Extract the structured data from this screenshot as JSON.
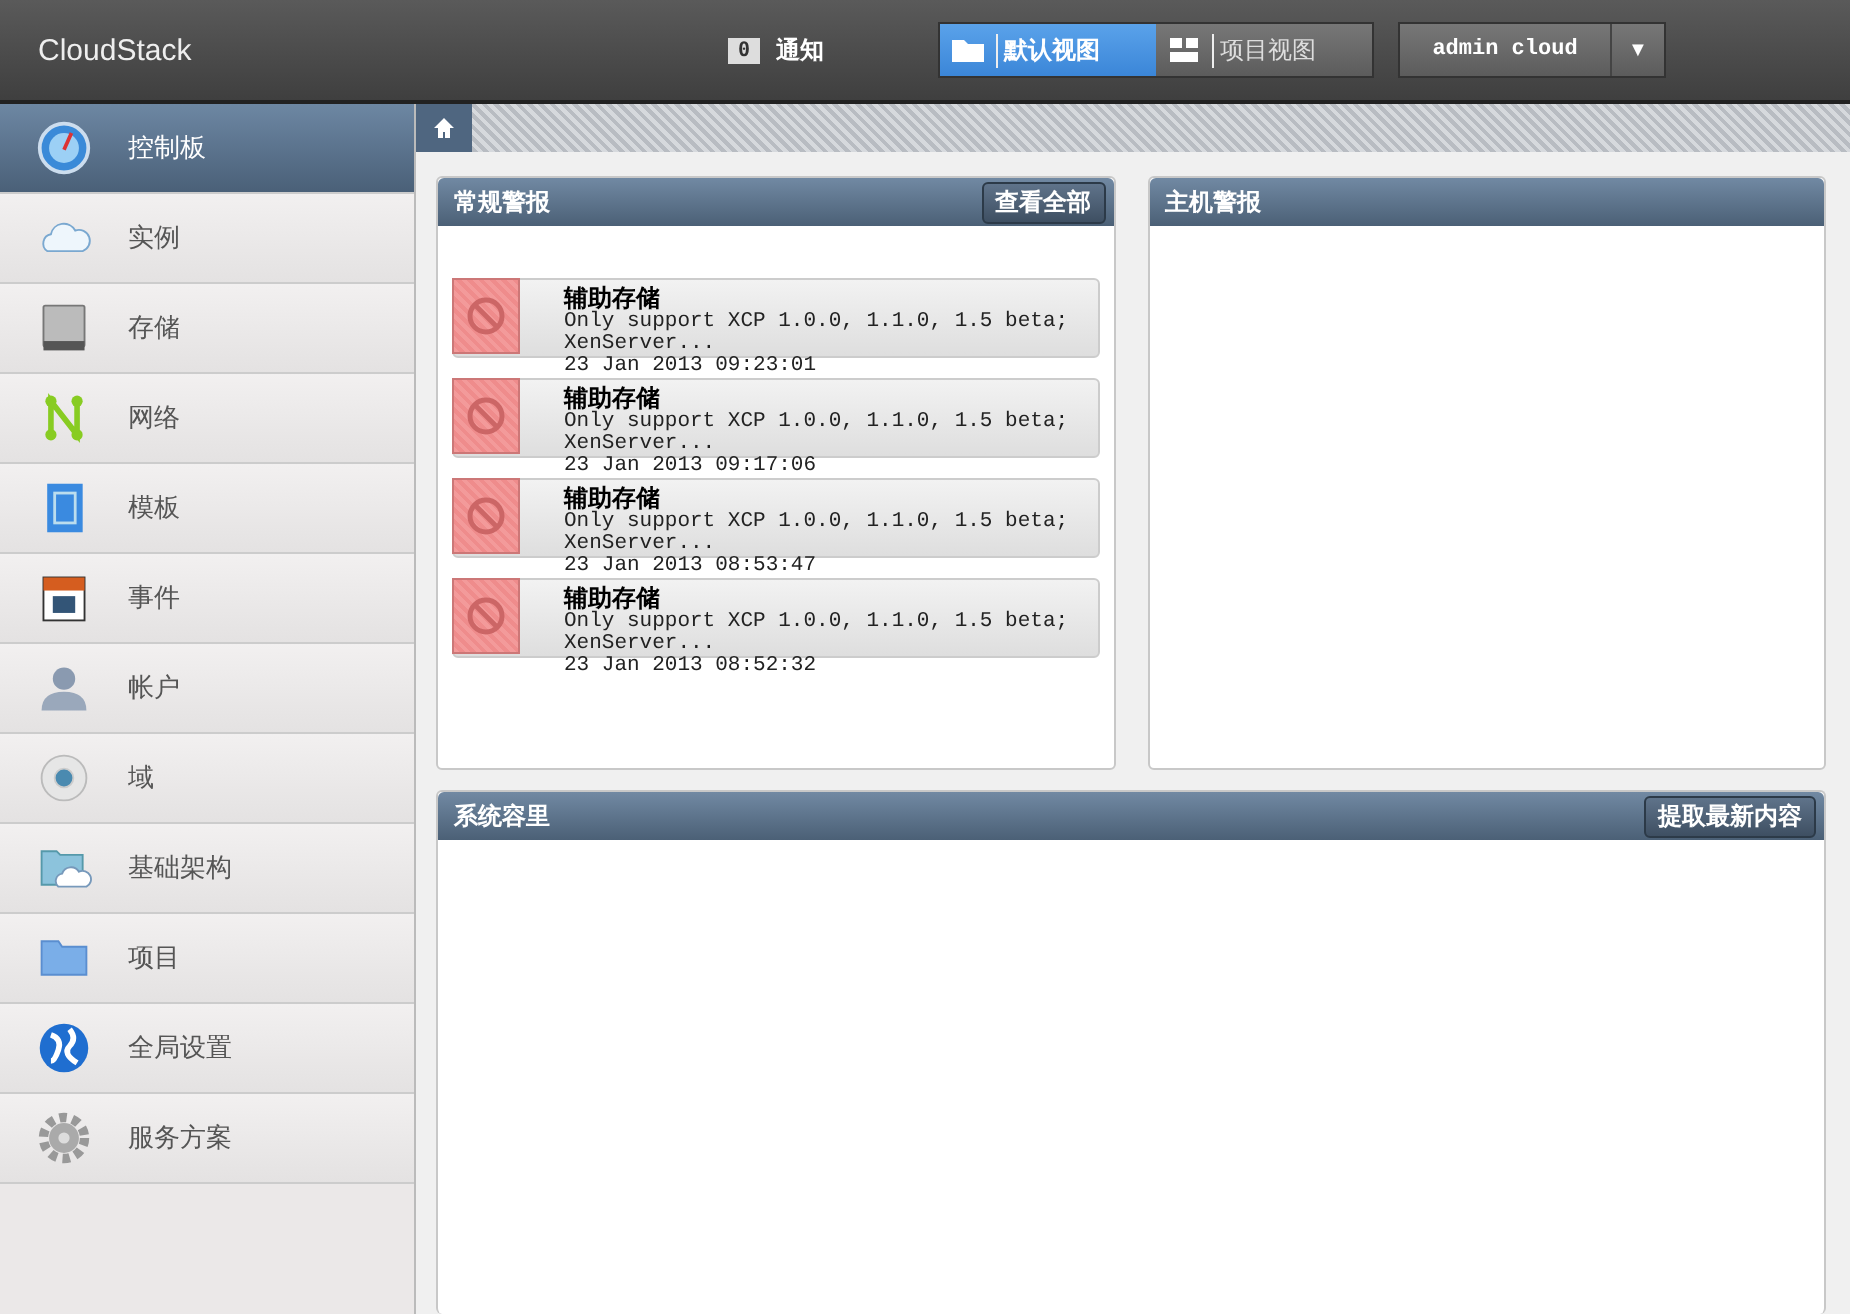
{
  "app": {
    "title": "CloudStack"
  },
  "notifications": {
    "count": "0",
    "label": "通知"
  },
  "views": [
    {
      "label": "默认视图",
      "selected": true,
      "kind": "folder"
    },
    {
      "label": "项目视图",
      "selected": false,
      "kind": "grid"
    }
  ],
  "user": {
    "name": "admin cloud",
    "caret": "▼"
  },
  "sidebar": {
    "items": [
      {
        "label": "控制板",
        "selected": true,
        "kind": "gauge"
      },
      {
        "label": "实例",
        "selected": false,
        "kind": "cloud"
      },
      {
        "label": "存储",
        "selected": false,
        "kind": "disk"
      },
      {
        "label": "网络",
        "selected": false,
        "kind": "network"
      },
      {
        "label": "模板",
        "selected": false,
        "kind": "template"
      },
      {
        "label": "事件",
        "selected": false,
        "kind": "calendar"
      },
      {
        "label": "帐户",
        "selected": false,
        "kind": "user"
      },
      {
        "label": "域",
        "selected": false,
        "kind": "disc"
      },
      {
        "label": "基础架构",
        "selected": false,
        "kind": "infra"
      },
      {
        "label": "项目",
        "selected": false,
        "kind": "folder"
      },
      {
        "label": "全局设置",
        "selected": false,
        "kind": "globe"
      },
      {
        "label": "服务方案",
        "selected": false,
        "kind": "gear"
      }
    ]
  },
  "general_alerts": {
    "title": "常规警报",
    "button": "查看全部",
    "alerts": [
      {
        "title": "辅助存储",
        "message": "Only support XCP 1.0.0, 1.1.0, 1.5 beta; XenServer...",
        "time": "23 Jan 2013 09:23:01"
      },
      {
        "title": "辅助存储",
        "message": "Only support XCP 1.0.0, 1.1.0, 1.5 beta; XenServer...",
        "time": "23 Jan 2013 09:17:06"
      },
      {
        "title": "辅助存储",
        "message": "Only support XCP 1.0.0, 1.1.0, 1.5 beta; XenServer...",
        "time": "23 Jan 2013 08:53:47"
      },
      {
        "title": "辅助存储",
        "message": "Only support XCP 1.0.0, 1.1.0, 1.5 beta; XenServer...",
        "time": "23 Jan 2013 08:52:32"
      }
    ]
  },
  "host_alerts": {
    "title": "主机警报"
  },
  "system_capacity": {
    "title": "系统容里",
    "button": "提取最新内容"
  }
}
